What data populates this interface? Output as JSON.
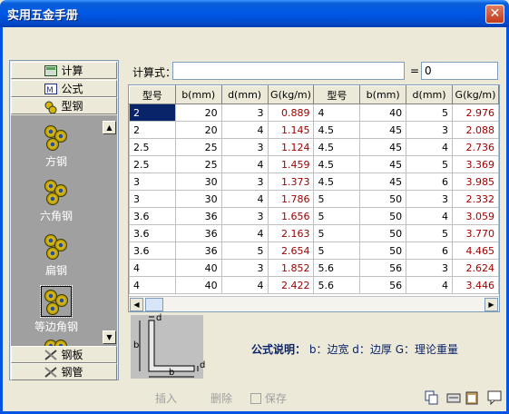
{
  "window": {
    "title": "实用五金手册",
    "close_glyph": "✕"
  },
  "nav": {
    "top_items": [
      {
        "label": "计算",
        "icon": "calculator-icon"
      },
      {
        "label": "公式",
        "icon": "formula-icon"
      },
      {
        "label": "型钢",
        "icon": "gears-icon"
      }
    ],
    "list_items": [
      {
        "label": "方钢"
      },
      {
        "label": "六角钢"
      },
      {
        "label": "扁钢"
      },
      {
        "label": "等边角钢"
      }
    ],
    "bottom_items": [
      {
        "label": "钢板",
        "icon": "tools-icon"
      },
      {
        "label": "钢管",
        "icon": "tools-icon"
      }
    ]
  },
  "formula": {
    "label": "计算式：",
    "value": "",
    "equals": "=",
    "result": "0"
  },
  "table": {
    "headers": [
      "型号",
      "b(mm)",
      "d(mm)",
      "G(kg/m)",
      "型号",
      "b(mm)",
      "d(mm)",
      "G(kg/m)"
    ],
    "rows": [
      [
        "2",
        "20",
        "3",
        "0.889",
        "4",
        "40",
        "5",
        "2.976"
      ],
      [
        "2",
        "20",
        "4",
        "1.145",
        "4.5",
        "45",
        "3",
        "2.088"
      ],
      [
        "2.5",
        "25",
        "3",
        "1.124",
        "4.5",
        "45",
        "4",
        "2.736"
      ],
      [
        "2.5",
        "25",
        "4",
        "1.459",
        "4.5",
        "45",
        "5",
        "3.369"
      ],
      [
        "3",
        "30",
        "3",
        "1.373",
        "4.5",
        "45",
        "6",
        "3.985"
      ],
      [
        "3",
        "30",
        "4",
        "1.786",
        "5",
        "50",
        "3",
        "2.332"
      ],
      [
        "3.6",
        "36",
        "3",
        "1.656",
        "5",
        "50",
        "4",
        "3.059"
      ],
      [
        "3.6",
        "36",
        "4",
        "2.163",
        "5",
        "50",
        "5",
        "3.770"
      ],
      [
        "3.6",
        "36",
        "5",
        "2.654",
        "5",
        "50",
        "6",
        "4.465"
      ],
      [
        "4",
        "40",
        "3",
        "1.852",
        "5.6",
        "56",
        "3",
        "2.624"
      ],
      [
        "4",
        "40",
        "4",
        "2.422",
        "5.6",
        "56",
        "4",
        "3.446"
      ]
    ]
  },
  "diagram": {
    "label_b_left": "b",
    "label_b_bottom": "b",
    "label_d_top": "d",
    "label_d_right": "d"
  },
  "note": {
    "title": "公式说明：",
    "text": "b：边宽 d：边厚 G：理论重量"
  },
  "toolbar": {
    "insert": "插入",
    "delete": "删除",
    "save": "保存"
  },
  "colors": {
    "selection": "#0a246a",
    "weight_text": "#a00000",
    "titlebar": "#0058e6"
  }
}
